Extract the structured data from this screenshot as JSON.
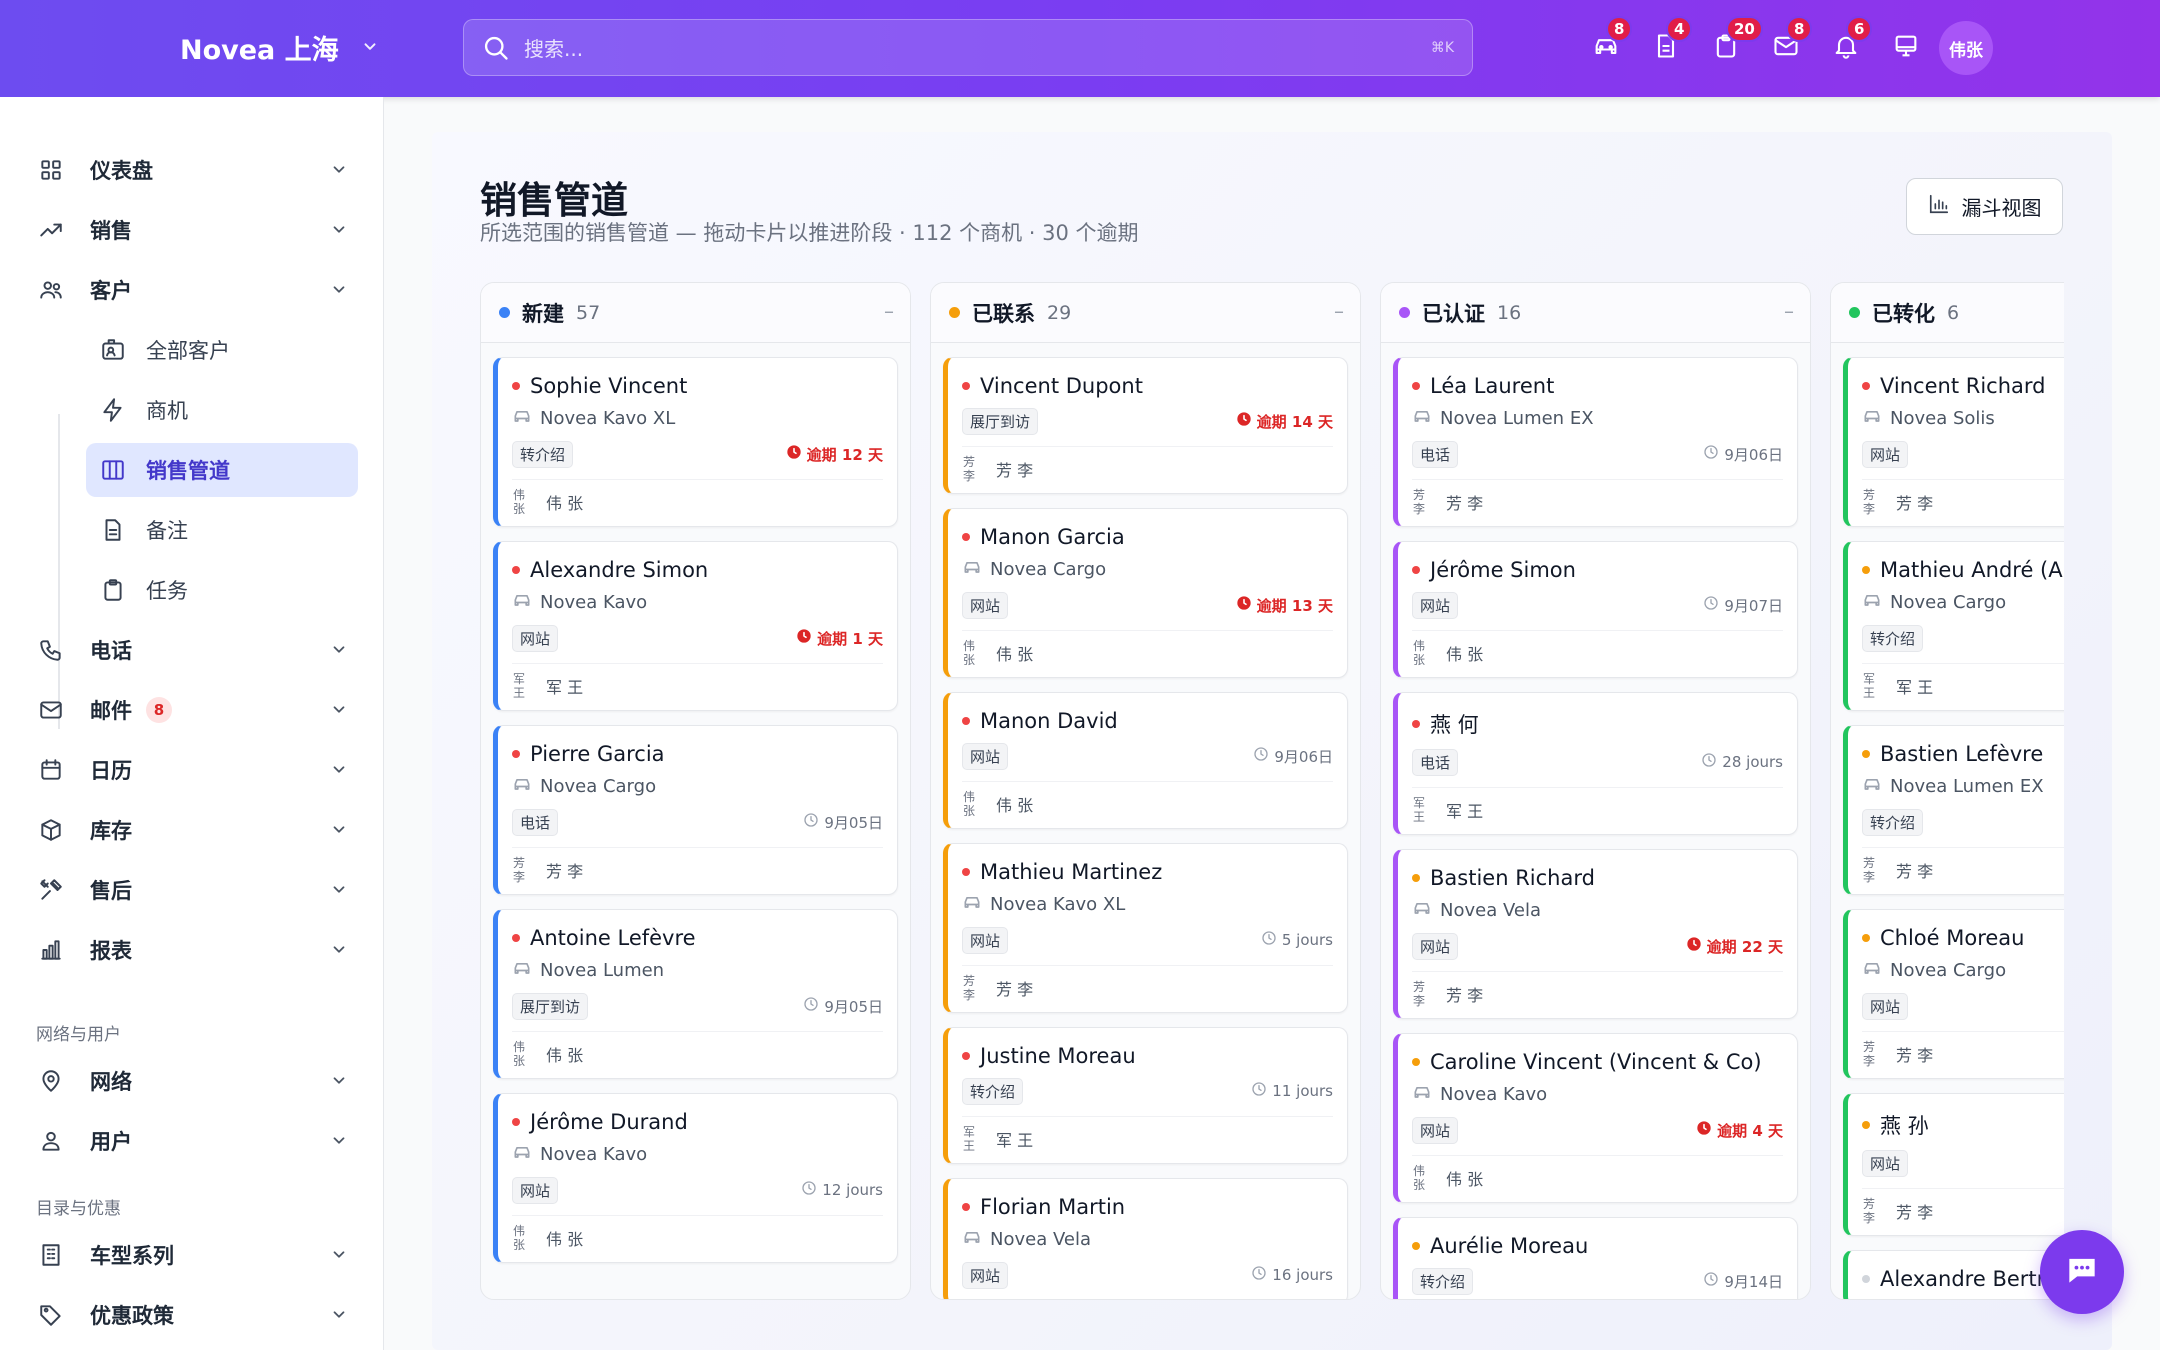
{
  "app": {
    "brand": "Novea 上海"
  },
  "search": {
    "placeholder": "搜索...",
    "shortcut": "⌘K"
  },
  "top_icons": [
    {
      "icon": "car-icon",
      "badge": "8"
    },
    {
      "icon": "document-icon",
      "badge": "4"
    },
    {
      "icon": "clipboard-icon",
      "badge": "20"
    },
    {
      "icon": "mail-icon",
      "badge": "8"
    },
    {
      "icon": "bell-icon",
      "badge": "6"
    },
    {
      "icon": "monitor-icon",
      "badge": ""
    }
  ],
  "user": {
    "initials": "伟张"
  },
  "sidebar": {
    "items": [
      {
        "label": "仪表盘",
        "icon": "grid-icon"
      },
      {
        "label": "销售",
        "icon": "trending-up-icon"
      },
      {
        "label": "客户",
        "icon": "users-icon"
      },
      {
        "label": "电话",
        "icon": "phone-icon"
      },
      {
        "label": "邮件",
        "icon": "mail-icon",
        "badge": "8"
      },
      {
        "label": "日历",
        "icon": "calendar-icon"
      },
      {
        "label": "库存",
        "icon": "box-icon"
      },
      {
        "label": "售后",
        "icon": "tools-icon"
      },
      {
        "label": "报表",
        "icon": "bar-chart-icon"
      },
      {
        "label": "网络",
        "icon": "map-pin-icon"
      },
      {
        "label": "用户",
        "icon": "user-icon"
      },
      {
        "label": "车型系列",
        "icon": "building-icon"
      },
      {
        "label": "优惠政策",
        "icon": "tag-icon"
      }
    ],
    "sub_items": [
      {
        "label": "全部客户",
        "icon": "contact-card-icon"
      },
      {
        "label": "商机",
        "icon": "lightning-icon"
      },
      {
        "label": "销售管道",
        "icon": "columns-icon"
      },
      {
        "label": "备注",
        "icon": "note-icon"
      },
      {
        "label": "任务",
        "icon": "clipboard-icon"
      }
    ],
    "sections": [
      "网络与用户",
      "目录与优惠"
    ]
  },
  "page": {
    "title": "销售管道",
    "subtitle": "所选范围的销售管道 — 拖动卡片以推进阶段 · 112 个商机 · 30 个逾期",
    "funnel_button": "漏斗视图"
  },
  "colors": {
    "new": "#3b82f6",
    "contacted": "#f59e0b",
    "qualified": "#a855f7",
    "converted": "#22c55e",
    "overdue": "#dc2626",
    "hot": "#ef4444",
    "warm": "#f59e0b",
    "cold": "#d1d5db"
  },
  "columns": [
    {
      "name": "新建",
      "count": "57",
      "color": "#3b82f6",
      "minimize": "–",
      "cards": [
        {
          "name": "Sophie Vincent",
          "vehicle": "Novea Kavo XL",
          "tag": "转介绍",
          "due": "逾期 12 天",
          "overdue": true,
          "owner_initials": "伟张",
          "owner": "伟 张",
          "priority": "#ef4444"
        },
        {
          "name": "Alexandre Simon",
          "vehicle": "Novea Kavo",
          "tag": "网站",
          "due": "逾期 1 天",
          "overdue": true,
          "owner_initials": "军王",
          "owner": "军 王",
          "priority": "#ef4444"
        },
        {
          "name": "Pierre Garcia",
          "vehicle": "Novea Cargo",
          "tag": "电话",
          "due": "9月05日",
          "overdue": false,
          "owner_initials": "芳李",
          "owner": "芳 李",
          "priority": "#ef4444"
        },
        {
          "name": "Antoine Lefèvre",
          "vehicle": "Novea Lumen",
          "tag": "展厅到访",
          "due": "9月05日",
          "overdue": false,
          "owner_initials": "伟张",
          "owner": "伟 张",
          "priority": "#ef4444"
        },
        {
          "name": "Jérôme Durand",
          "vehicle": "Novea Kavo",
          "tag": "网站",
          "due": "12 jours",
          "overdue": false,
          "owner_initials": "伟张",
          "owner": "伟 张",
          "priority": "#ef4444"
        }
      ]
    },
    {
      "name": "已联系",
      "count": "29",
      "color": "#f59e0b",
      "minimize": "–",
      "cards": [
        {
          "name": "Vincent Dupont",
          "vehicle": "",
          "tag": "展厅到访",
          "due": "逾期 14 天",
          "overdue": true,
          "owner_initials": "芳李",
          "owner": "芳 李",
          "priority": "#ef4444"
        },
        {
          "name": "Manon Garcia",
          "vehicle": "Novea Cargo",
          "tag": "网站",
          "due": "逾期 13 天",
          "overdue": true,
          "owner_initials": "伟张",
          "owner": "伟 张",
          "priority": "#ef4444"
        },
        {
          "name": "Manon David",
          "vehicle": "",
          "tag": "网站",
          "due": "9月06日",
          "overdue": false,
          "owner_initials": "伟张",
          "owner": "伟 张",
          "priority": "#ef4444"
        },
        {
          "name": "Mathieu Martinez",
          "vehicle": "Novea Kavo XL",
          "tag": "网站",
          "due": "5 jours",
          "overdue": false,
          "owner_initials": "芳李",
          "owner": "芳 李",
          "priority": "#ef4444"
        },
        {
          "name": "Justine Moreau",
          "vehicle": "",
          "tag": "转介绍",
          "due": "11 jours",
          "overdue": false,
          "owner_initials": "军王",
          "owner": "军 王",
          "priority": "#ef4444"
        },
        {
          "name": "Florian Martin",
          "vehicle": "Novea Vela",
          "tag": "网站",
          "due": "16 jours",
          "overdue": false,
          "owner_initials": "",
          "owner": "",
          "priority": "#ef4444"
        }
      ]
    },
    {
      "name": "已认证",
      "count": "16",
      "color": "#a855f7",
      "minimize": "–",
      "cards": [
        {
          "name": "Léa Laurent",
          "vehicle": "Novea Lumen EX",
          "tag": "电话",
          "due": "9月06日",
          "overdue": false,
          "owner_initials": "芳李",
          "owner": "芳 李",
          "priority": "#ef4444"
        },
        {
          "name": "Jérôme Simon",
          "vehicle": "",
          "tag": "网站",
          "due": "9月07日",
          "overdue": false,
          "owner_initials": "伟张",
          "owner": "伟 张",
          "priority": "#ef4444"
        },
        {
          "name": "燕 何",
          "vehicle": "",
          "tag": "电话",
          "due": "28 jours",
          "overdue": false,
          "owner_initials": "军王",
          "owner": "军 王",
          "priority": "#ef4444"
        },
        {
          "name": "Bastien Richard",
          "vehicle": "Novea Vela",
          "tag": "网站",
          "due": "逾期 22 天",
          "overdue": true,
          "owner_initials": "芳李",
          "owner": "芳 李",
          "priority": "#f59e0b"
        },
        {
          "name": "Caroline Vincent (Vincent & Co)",
          "vehicle": "Novea Kavo",
          "tag": "网站",
          "due": "逾期 4 天",
          "overdue": true,
          "owner_initials": "伟张",
          "owner": "伟 张",
          "priority": "#f59e0b"
        },
        {
          "name": "Aurélie Moreau",
          "vehicle": "",
          "tag": "转介绍",
          "due": "9月14日",
          "overdue": false,
          "owner_initials": "",
          "owner": "",
          "priority": "#f59e0b"
        }
      ]
    },
    {
      "name": "已转化",
      "count": "6",
      "color": "#22c55e",
      "minimize": "",
      "cards": [
        {
          "name": "Vincent Richard",
          "vehicle": "Novea Solis",
          "tag": "网站",
          "due": "",
          "overdue": false,
          "owner_initials": "芳李",
          "owner": "芳 李",
          "priority": "#ef4444"
        },
        {
          "name": "Mathieu André (Ar",
          "vehicle": "Novea Cargo",
          "tag": "转介绍",
          "due": "",
          "overdue": false,
          "owner_initials": "军王",
          "owner": "军 王",
          "priority": "#f59e0b"
        },
        {
          "name": "Bastien Lefèvre",
          "vehicle": "Novea Lumen EX",
          "tag": "转介绍",
          "due": "",
          "overdue": false,
          "owner_initials": "芳李",
          "owner": "芳 李",
          "priority": "#f59e0b"
        },
        {
          "name": "Chloé Moreau",
          "vehicle": "Novea Cargo",
          "tag": "网站",
          "due": "",
          "overdue": false,
          "owner_initials": "芳李",
          "owner": "芳 李",
          "priority": "#f59e0b"
        },
        {
          "name": "燕 孙",
          "vehicle": "",
          "tag": "网站",
          "due": "",
          "overdue": false,
          "owner_initials": "芳李",
          "owner": "芳 李",
          "priority": "#f59e0b"
        },
        {
          "name": "Alexandre Bertra",
          "vehicle": "",
          "tag": "",
          "due": "",
          "overdue": false,
          "owner_initials": "",
          "owner": "",
          "priority": "#d1d5db"
        }
      ]
    }
  ]
}
